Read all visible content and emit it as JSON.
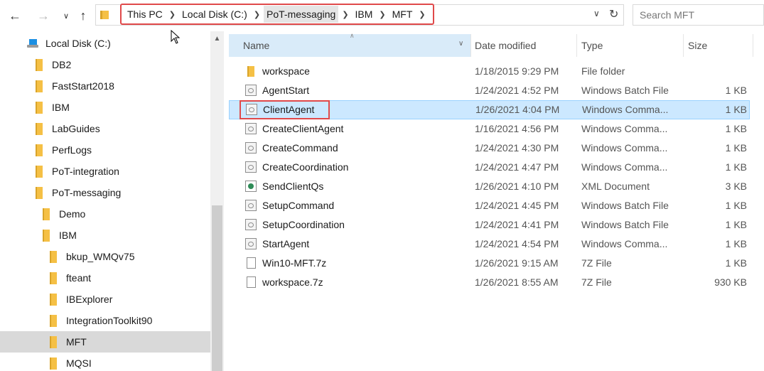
{
  "window": {
    "search_placeholder": "Search MFT",
    "breadcrumb": [
      "This PC",
      "Local Disk (C:)",
      "PoT-messaging",
      "IBM",
      "MFT"
    ]
  },
  "nav": {
    "items": [
      {
        "label": "Local Disk (C:)",
        "type": "drive"
      },
      {
        "label": "DB2",
        "type": "folder"
      },
      {
        "label": "FastStart2018",
        "type": "folder"
      },
      {
        "label": "IBM",
        "type": "folder"
      },
      {
        "label": "LabGuides",
        "type": "folder"
      },
      {
        "label": "PerfLogs",
        "type": "folder"
      },
      {
        "label": "PoT-integration",
        "type": "folder"
      },
      {
        "label": "PoT-messaging",
        "type": "folder"
      },
      {
        "label": "Demo",
        "type": "folder"
      },
      {
        "label": "IBM",
        "type": "folder"
      },
      {
        "label": "bkup_WMQv75",
        "type": "folder"
      },
      {
        "label": "fteant",
        "type": "folder"
      },
      {
        "label": "IBExplorer",
        "type": "folder"
      },
      {
        "label": "IntegrationToolkit90",
        "type": "folder"
      },
      {
        "label": "MFT",
        "type": "folder",
        "selected": true
      },
      {
        "label": "MQSI",
        "type": "folder"
      }
    ]
  },
  "columns": {
    "name": "Name",
    "date": "Date modified",
    "type": "Type",
    "size": "Size"
  },
  "files": [
    {
      "name": "workspace",
      "date": "1/18/2015 9:29 PM",
      "type": "File folder",
      "size": "",
      "icon": "folder-icon"
    },
    {
      "name": "AgentStart",
      "date": "1/24/2021 4:52 PM",
      "type": "Windows Batch File",
      "size": "1 KB",
      "icon": "batch-file-icon"
    },
    {
      "name": "ClientAgent",
      "date": "1/26/2021 4:04 PM",
      "type": "Windows Comma...",
      "size": "1 KB",
      "icon": "batch-file-icon",
      "selected": true
    },
    {
      "name": "CreateClientAgent",
      "date": "1/16/2021 4:56 PM",
      "type": "Windows Comma...",
      "size": "1 KB",
      "icon": "batch-file-icon"
    },
    {
      "name": "CreateCommand",
      "date": "1/24/2021 4:30 PM",
      "type": "Windows Comma...",
      "size": "1 KB",
      "icon": "batch-file-icon"
    },
    {
      "name": "CreateCoordination",
      "date": "1/24/2021 4:47 PM",
      "type": "Windows Comma...",
      "size": "1 KB",
      "icon": "batch-file-icon"
    },
    {
      "name": "SendClientQs",
      "date": "1/26/2021 4:10 PM",
      "type": "XML Document",
      "size": "3 KB",
      "icon": "xml-file-icon"
    },
    {
      "name": "SetupCommand",
      "date": "1/24/2021 4:45 PM",
      "type": "Windows Batch File",
      "size": "1 KB",
      "icon": "batch-file-icon"
    },
    {
      "name": "SetupCoordination",
      "date": "1/24/2021 4:41 PM",
      "type": "Windows Batch File",
      "size": "1 KB",
      "icon": "batch-file-icon"
    },
    {
      "name": "StartAgent",
      "date": "1/24/2021 4:54 PM",
      "type": "Windows Comma...",
      "size": "1 KB",
      "icon": "batch-file-icon"
    },
    {
      "name": "Win10-MFT.7z",
      "date": "1/26/2021 9:15 AM",
      "type": "7Z File",
      "size": "1 KB",
      "icon": "file-icon"
    },
    {
      "name": "workspace.7z",
      "date": "1/26/2021 8:55 AM",
      "type": "7Z File",
      "size": "930 KB",
      "icon": "file-icon"
    }
  ],
  "colors": {
    "selection": "#cce8ff",
    "highlight_box": "#e0494a",
    "folder": "#f5c045"
  }
}
